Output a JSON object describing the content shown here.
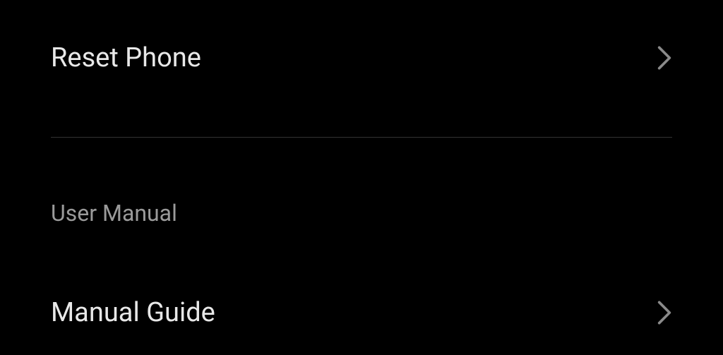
{
  "settings": {
    "items": [
      {
        "label": "Reset Phone"
      }
    ],
    "section_header": "User Manual",
    "manual_items": [
      {
        "label": "Manual Guide"
      }
    ]
  }
}
